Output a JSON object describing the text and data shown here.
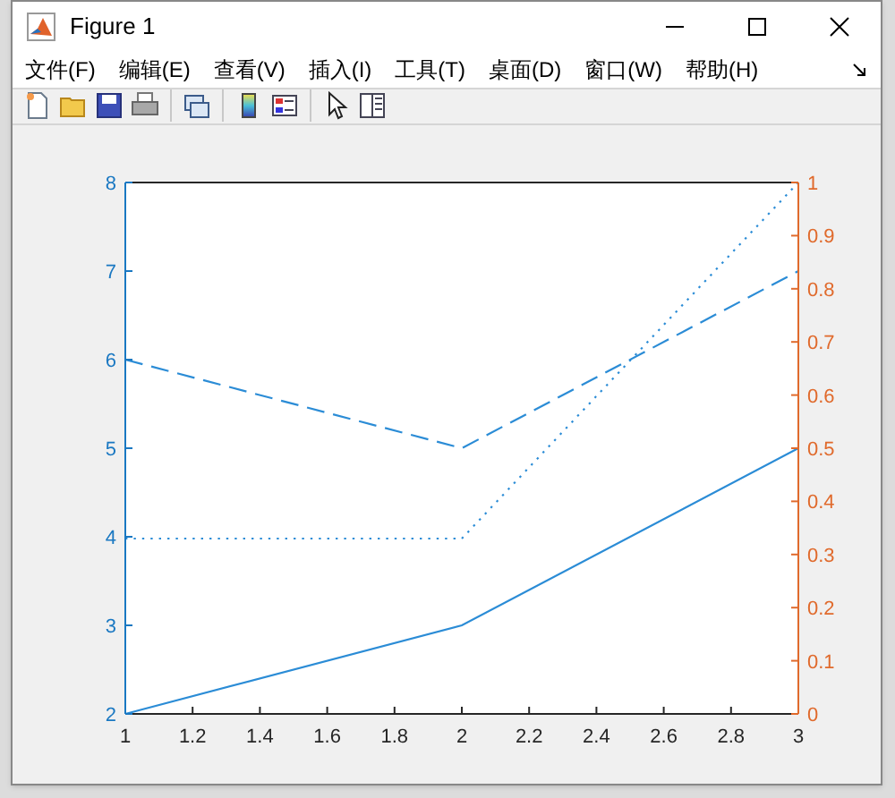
{
  "window": {
    "title": "Figure 1"
  },
  "menu": [
    {
      "label": "文件(F)"
    },
    {
      "label": "编辑(E)"
    },
    {
      "label": "查看(V)"
    },
    {
      "label": "插入(I)"
    },
    {
      "label": "工具(T)"
    },
    {
      "label": "桌面(D)"
    },
    {
      "label": "窗口(W)"
    },
    {
      "label": "帮助(H)"
    }
  ],
  "toolbar": [
    {
      "kind": "new"
    },
    {
      "kind": "open"
    },
    {
      "kind": "save"
    },
    {
      "kind": "print"
    },
    {
      "kind": "separator"
    },
    {
      "kind": "link"
    },
    {
      "kind": "separator"
    },
    {
      "kind": "colorbar"
    },
    {
      "kind": "legend"
    },
    {
      "kind": "separator"
    },
    {
      "kind": "pointer"
    },
    {
      "kind": "panel"
    }
  ],
  "chart_data": {
    "type": "line",
    "x": [
      1,
      2,
      3
    ],
    "xlim": [
      1,
      3
    ],
    "ylim": [
      2,
      8
    ],
    "y2lim": [
      0,
      1
    ],
    "xticks": [
      1,
      {
        "value": 1.2,
        "label": "1.2"
      },
      {
        "value": 1.4,
        "label": "1.4"
      },
      {
        "value": 1.6,
        "label": "1.6"
      },
      {
        "value": 1.8,
        "label": "1.8"
      },
      2,
      {
        "value": 2.2,
        "label": "2.2"
      },
      {
        "value": 2.4,
        "label": "2.4"
      },
      {
        "value": 2.6,
        "label": "2.6"
      },
      {
        "value": 2.8,
        "label": "2.8"
      },
      3
    ],
    "yticks": [
      2,
      3,
      4,
      5,
      6,
      7,
      8
    ],
    "y2ticks": [
      0,
      {
        "value": 0.1,
        "label": "0.1"
      },
      {
        "value": 0.2,
        "label": "0.2"
      },
      {
        "value": 0.3,
        "label": "0.3"
      },
      {
        "value": 0.4,
        "label": "0.4"
      },
      {
        "value": 0.5,
        "label": "0.5"
      },
      {
        "value": 0.6,
        "label": "0.6"
      },
      {
        "value": 0.7,
        "label": "0.7"
      },
      {
        "value": 0.8,
        "label": "0.8"
      },
      {
        "value": 0.9,
        "label": "0.9"
      },
      1
    ],
    "series": [
      {
        "color": "#2b8cd6",
        "line_style": "solid",
        "values": [
          2,
          3,
          5
        ]
      },
      {
        "color": "#2b8cd6",
        "line_style": "dashed",
        "values": [
          6,
          5,
          7
        ]
      },
      {
        "color": "#2b8cd6",
        "line_style": "dotted",
        "axis": "y2",
        "values": [
          0.33,
          0.33,
          1
        ]
      }
    ]
  }
}
